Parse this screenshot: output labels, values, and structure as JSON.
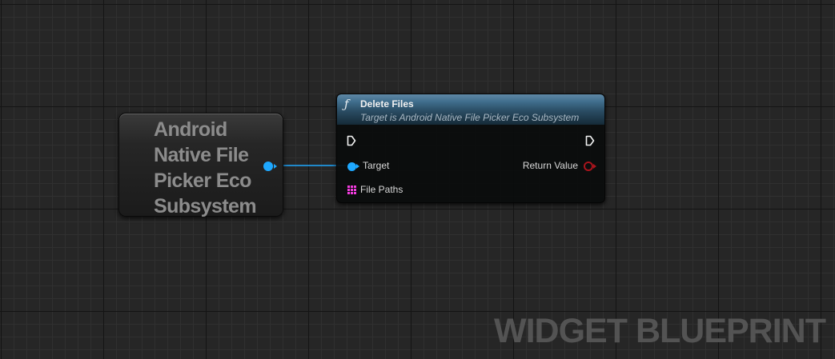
{
  "self_node": {
    "label": "Android\nNative File\nPicker Eco\nSubsystem",
    "pin_color": "#1ea8ff"
  },
  "function_node": {
    "icon": "function-icon",
    "title": "Delete Files",
    "subtitle": "Target is Android Native File Picker Eco Subsystem",
    "header_color": "#3f6d8c",
    "pins": {
      "exec_in_icon": "exec-pin-icon",
      "exec_out_icon": "exec-pin-icon",
      "target_label": "Target",
      "target_color": "#1ea8ff",
      "return_label": "Return Value",
      "return_color": "#a8141c",
      "file_paths_label": "File Paths",
      "file_paths_color": "#f03cdc"
    }
  },
  "watermark": "WIDGET BLUEPRINT"
}
